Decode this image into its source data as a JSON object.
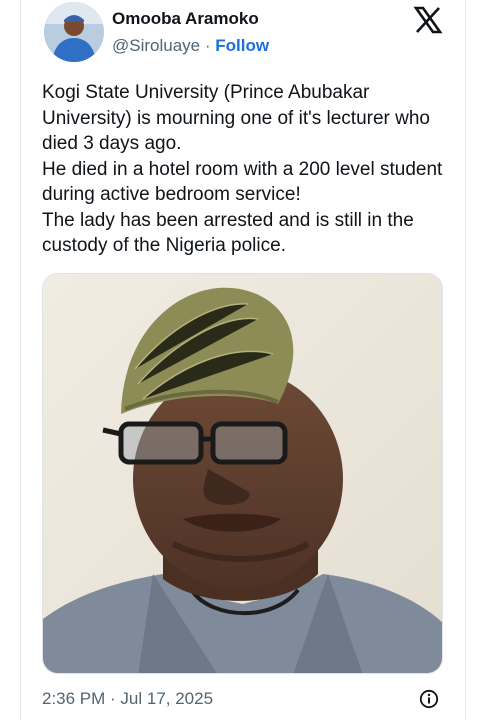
{
  "author": {
    "name": "Omooba Aramoko",
    "handle": "@Siroluaye",
    "separator": "·",
    "follow_label": "Follow"
  },
  "tweet": {
    "lines": [
      "Kogi State University (Prince Abubakar",
      "University) is mourning one of it's lecturer who",
      "died 3 days ago.",
      "He died in a hotel room with a 200 level student",
      "during  active bedroom service!",
      "The lady has been arrested and is still in the",
      "custody of the Nigeria police."
    ]
  },
  "meta": {
    "timestamp": "2:36 PM · Jul 17, 2025"
  },
  "icons": {
    "brand": "x-logo-icon",
    "info": "info-icon"
  },
  "colors": {
    "follow": "#1d6fd8",
    "secondary_text": "#536471",
    "primary_text": "#0f1419"
  }
}
